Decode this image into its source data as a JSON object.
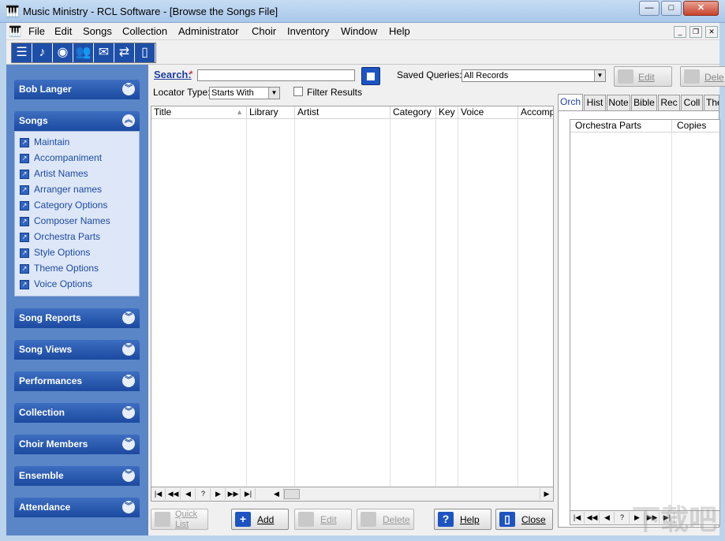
{
  "window": {
    "title": "Music Ministry - RCL Software - [Browse the Songs File]",
    "min_label": "—",
    "max_label": "□",
    "close_label": "✕"
  },
  "menu": {
    "items": [
      "File",
      "Edit",
      "Songs",
      "Collection",
      "Administrator",
      "Choir",
      "Inventory",
      "Window",
      "Help"
    ],
    "mdi": [
      "_",
      "❐",
      "✕"
    ]
  },
  "toolbar": {
    "icons": [
      "list-icon",
      "music-note-icon",
      "disc-icon",
      "people-icon",
      "envelope-icon",
      "transfer-icon",
      "door-icon"
    ]
  },
  "sidebar": {
    "user": "Bob Langer",
    "groups": [
      {
        "label": "Songs",
        "expanded": true
      },
      {
        "label": "Song Reports"
      },
      {
        "label": "Song Views"
      },
      {
        "label": "Performances"
      },
      {
        "label": "Collection"
      },
      {
        "label": "Choir Members"
      },
      {
        "label": "Ensemble"
      },
      {
        "label": "Attendance"
      }
    ],
    "songs_items": [
      "Maintain",
      "Accompaniment",
      "Artist Names",
      "Arranger names",
      "Category Options",
      "Composer Names",
      "Orchestra Parts",
      "Style Options",
      "Theme Options",
      "Voice Options"
    ]
  },
  "search": {
    "label": "Search:",
    "required_mark": "*",
    "value": "",
    "saved_queries_label": "Saved Queries:",
    "saved_queries_value": "All Records",
    "edit_label": "Edit",
    "delete_label": "Dele",
    "locator_label": "Locator Type:",
    "locator_value": "Starts With",
    "filter_label": "Filter Results"
  },
  "grid": {
    "columns": [
      "Title",
      "Library",
      "Artist",
      "Category",
      "Key",
      "Voice",
      "Accompa"
    ]
  },
  "nav": [
    "|◀",
    "◀◀",
    "◀",
    "?",
    "▶",
    "▶▶",
    "▶|"
  ],
  "tabs": [
    "Orch",
    "Hist",
    "Note",
    "Bible",
    "Rec",
    "Coll",
    "The"
  ],
  "parts_grid": {
    "columns": [
      "Orchestra Parts",
      "Copies"
    ]
  },
  "buttons": {
    "quick_list": "Quick List",
    "add": "Add",
    "edit": "Edit",
    "delete": "Delete",
    "help": "Help",
    "close": "Close"
  },
  "watermark": "下载吧"
}
